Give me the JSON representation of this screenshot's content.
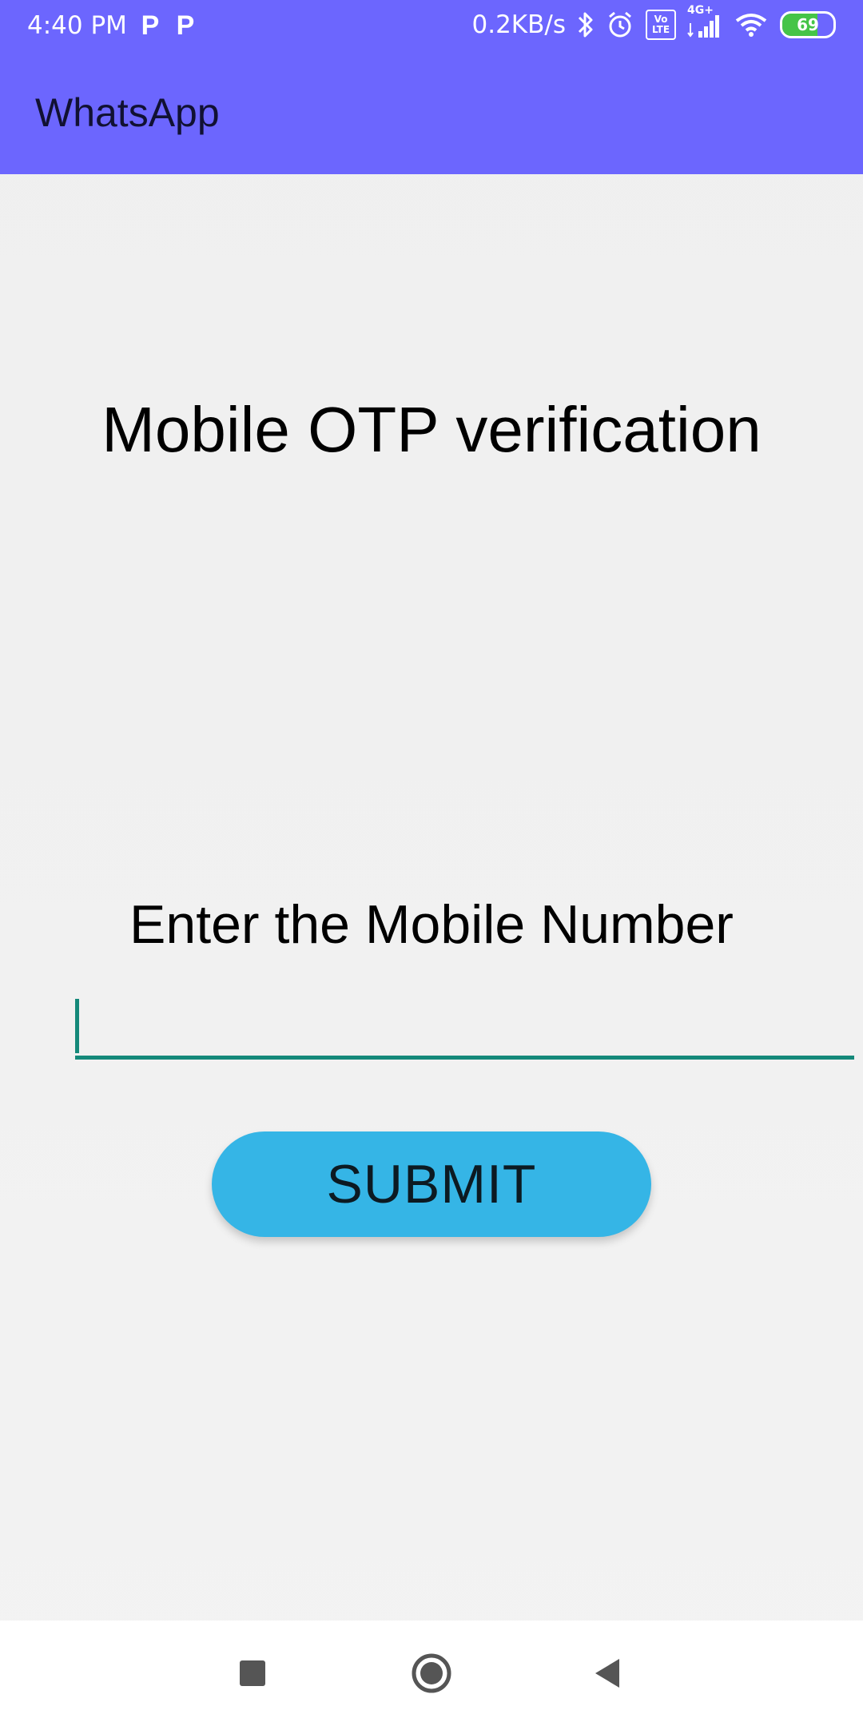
{
  "status_bar": {
    "time": "4:40 PM",
    "left_icons": [
      "P",
      "P"
    ],
    "network_speed": "0.2KB/s",
    "volte": [
      "Vo",
      "LTE"
    ],
    "network_type": "4G+",
    "battery_level": "69",
    "battery_fraction": 0.69
  },
  "app_bar": {
    "title": "WhatsApp"
  },
  "main": {
    "heading": "Mobile OTP verification",
    "prompt_label": "Enter the Mobile Number",
    "mobile_input": {
      "value": "",
      "placeholder": ""
    },
    "submit_label": "SUBMIT"
  },
  "colors": {
    "app_bar": "#6c66fe",
    "accent_underline": "#15897a",
    "submit_button": "#35b5e6",
    "background": "#f0f0f0"
  },
  "nav_bar": {
    "icons": [
      "recents-square-icon",
      "home-circle-icon",
      "back-triangle-icon"
    ]
  }
}
